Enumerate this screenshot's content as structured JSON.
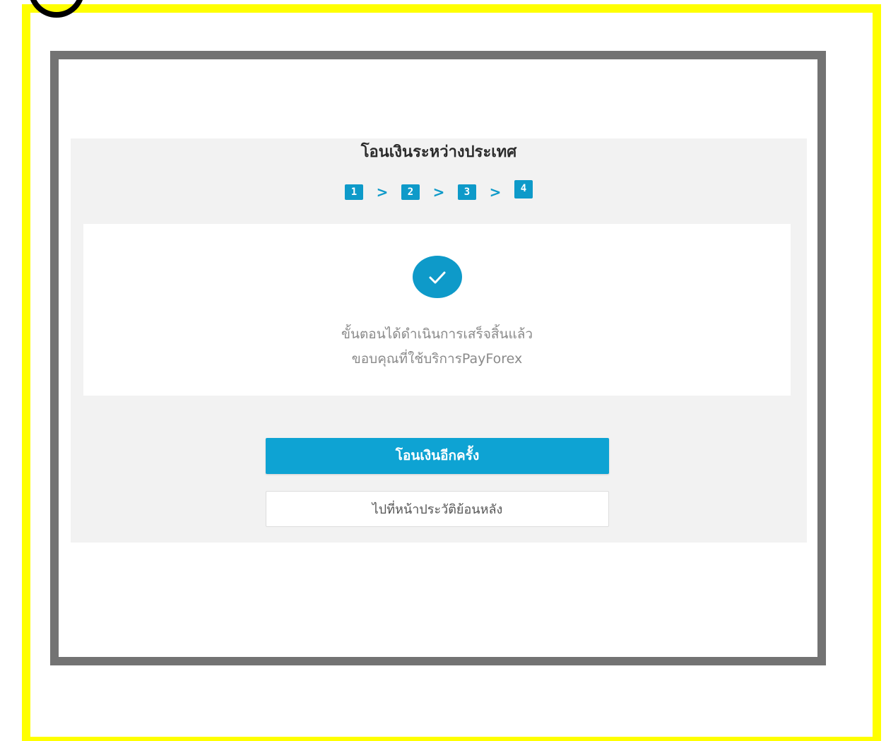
{
  "page": {
    "title": "โอนเงินระหว่างประเทศ"
  },
  "steps": [
    {
      "label": "1"
    },
    {
      "label": "2"
    },
    {
      "label": "3"
    },
    {
      "label": "4"
    }
  ],
  "step_separator": ">",
  "current_step": 4,
  "result": {
    "icon": "check-circle-icon",
    "line1": "ขั้นตอนได้ดำเนินการเสร็จสิ้นแล้ว",
    "line2": "ขอบคุณที่ใช้บริการPayForex"
  },
  "actions": {
    "transfer_again_label": "โอนเงินอีกครั้ง",
    "history_label": "ไปที่หน้าประวัติย้อนหลัง"
  },
  "colors": {
    "accent": "#0ea3d3",
    "highlight_frame": "#ffff00",
    "window_frame": "#737373",
    "panel_bg": "#f2f2f2"
  }
}
